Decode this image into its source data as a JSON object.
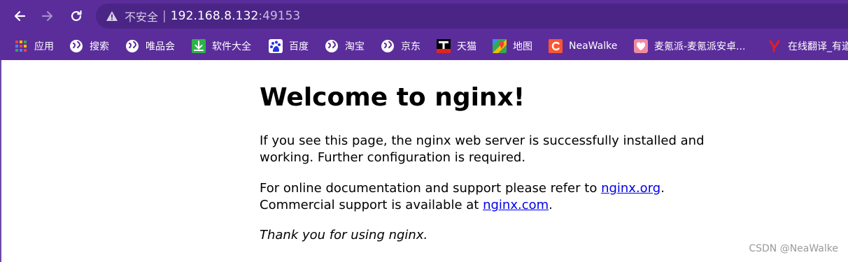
{
  "browser": {
    "address_bar": {
      "security_label": "不安全",
      "separator": "|",
      "host": "192.168.8.132",
      "port": ":49153"
    },
    "bookmarks": [
      {
        "label": "应用",
        "icon": "apps-grid-icon"
      },
      {
        "label": "搜索",
        "icon": "globe-icon"
      },
      {
        "label": "唯品会",
        "icon": "globe-icon"
      },
      {
        "label": "软件大全",
        "icon": "download-icon"
      },
      {
        "label": "百度",
        "icon": "baidu-paw-icon"
      },
      {
        "label": "淘宝",
        "icon": "globe-icon"
      },
      {
        "label": "京东",
        "icon": "globe-icon"
      },
      {
        "label": "天猫",
        "icon": "tmall-icon"
      },
      {
        "label": "地图",
        "icon": "maps-icon"
      },
      {
        "label": "NeaWalke",
        "icon": "csdn-c-icon"
      },
      {
        "label": "麦氪派-麦氪派安卓...",
        "icon": "heart-icon"
      },
      {
        "label": "在线翻译_有道",
        "icon": "youdao-icon"
      }
    ],
    "colors": {
      "chrome_purple": "#5b2d9b",
      "omnibox_purple": "#4a2586",
      "link_blue": "#0000ee"
    }
  },
  "page": {
    "title": "Welcome to nginx!",
    "paragraph1": "If you see this page, the nginx web server is successfully installed and working. Further configuration is required.",
    "paragraph2_prefix": "For online documentation and support please refer to ",
    "link_org": "nginx.org",
    "paragraph2_mid": ".",
    "paragraph2_line2": "Commercial support is available at ",
    "link_com": "nginx.com",
    "paragraph2_suffix": ".",
    "thanks": "Thank you for using nginx."
  },
  "watermark": "CSDN @NeaWalke"
}
